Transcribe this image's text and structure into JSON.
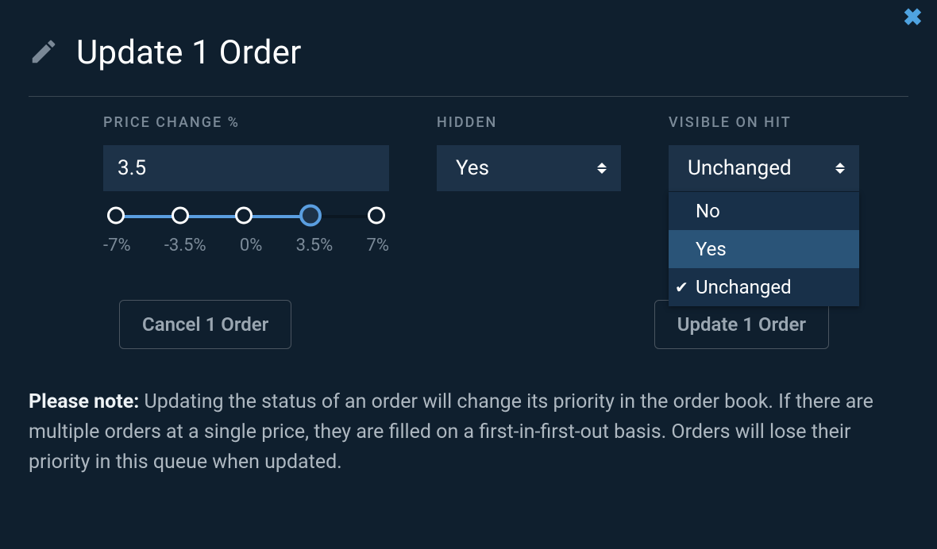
{
  "header": {
    "title": "Update 1 Order"
  },
  "fields": {
    "price_change": {
      "label": "PRICE CHANGE %",
      "value": "3.5",
      "slider_labels": [
        "-7%",
        "-3.5%",
        "0%",
        "3.5%",
        "7%"
      ]
    },
    "hidden": {
      "label": "HIDDEN",
      "value": "Yes"
    },
    "visible_on_hit": {
      "label": "VISIBLE ON HIT",
      "value": "Unchanged",
      "options": [
        "No",
        "Yes",
        "Unchanged"
      ]
    }
  },
  "buttons": {
    "cancel": "Cancel 1 Order",
    "update": "Update 1 Order"
  },
  "note": {
    "prefix": "Please note:",
    "body": " Updating the status of an order will change its priority in the order book. If there are multiple orders at a single price, they are filled on a first-in-first-out basis. Orders will lose their priority in this queue when updated."
  }
}
